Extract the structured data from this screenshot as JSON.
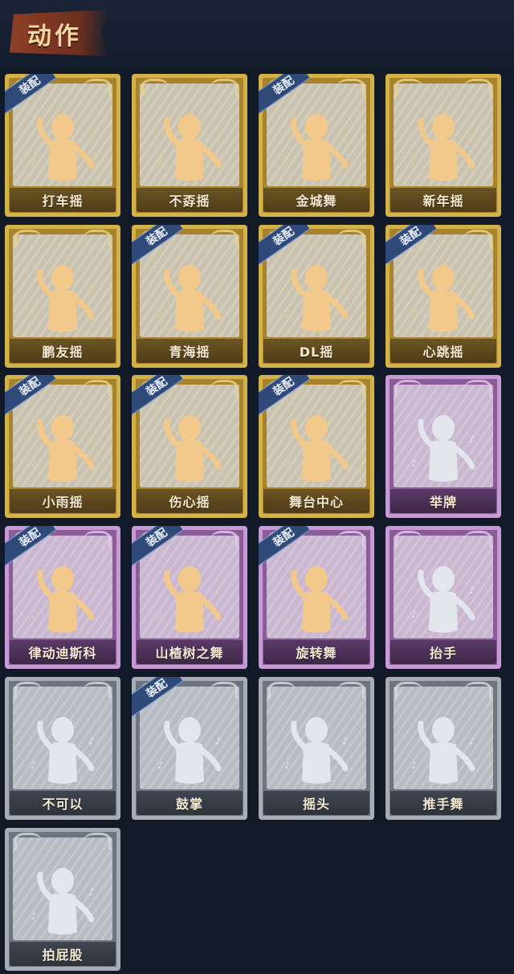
{
  "header": {
    "title": "动作"
  },
  "equipped_badge_label": "装配",
  "icons": {
    "figure_gold": "dance-figure-icon",
    "figure_silhouette": "dance-silhouette-icon"
  },
  "colors": {
    "background": "#121a28",
    "gold_rarity": "#d4b24a",
    "purple_rarity": "#c79ad6",
    "gray_locked": "#a7adb6",
    "badge": "#2f4a78"
  },
  "emotes": [
    {
      "label": "打车摇",
      "rarity": "gold",
      "equipped": true
    },
    {
      "label": "不孬摇",
      "rarity": "gold",
      "equipped": false
    },
    {
      "label": "金城舞",
      "rarity": "gold",
      "equipped": true
    },
    {
      "label": "新年摇",
      "rarity": "gold",
      "equipped": false
    },
    {
      "label": "鹏友摇",
      "rarity": "gold",
      "equipped": false
    },
    {
      "label": "青海摇",
      "rarity": "gold",
      "equipped": true
    },
    {
      "label": "DL摇",
      "rarity": "gold",
      "equipped": true
    },
    {
      "label": "心跳摇",
      "rarity": "gold",
      "equipped": true
    },
    {
      "label": "小雨摇",
      "rarity": "gold",
      "equipped": true
    },
    {
      "label": "伤心摇",
      "rarity": "gold",
      "equipped": true
    },
    {
      "label": "舞台中心",
      "rarity": "gold",
      "equipped": true
    },
    {
      "label": "举牌",
      "rarity": "purple",
      "equipped": false
    },
    {
      "label": "律动迪斯科",
      "rarity": "purple",
      "equipped": true
    },
    {
      "label": "山楂树之舞",
      "rarity": "purple",
      "equipped": true
    },
    {
      "label": "旋转舞",
      "rarity": "purple",
      "equipped": true
    },
    {
      "label": "抬手",
      "rarity": "purple",
      "equipped": false
    },
    {
      "label": "不可以",
      "rarity": "gray",
      "equipped": false
    },
    {
      "label": "鼓掌",
      "rarity": "gray",
      "equipped": true
    },
    {
      "label": "摇头",
      "rarity": "gray",
      "equipped": false
    },
    {
      "label": "推手舞",
      "rarity": "gray",
      "equipped": false
    },
    {
      "label": "拍屁股",
      "rarity": "gray",
      "equipped": false
    }
  ]
}
